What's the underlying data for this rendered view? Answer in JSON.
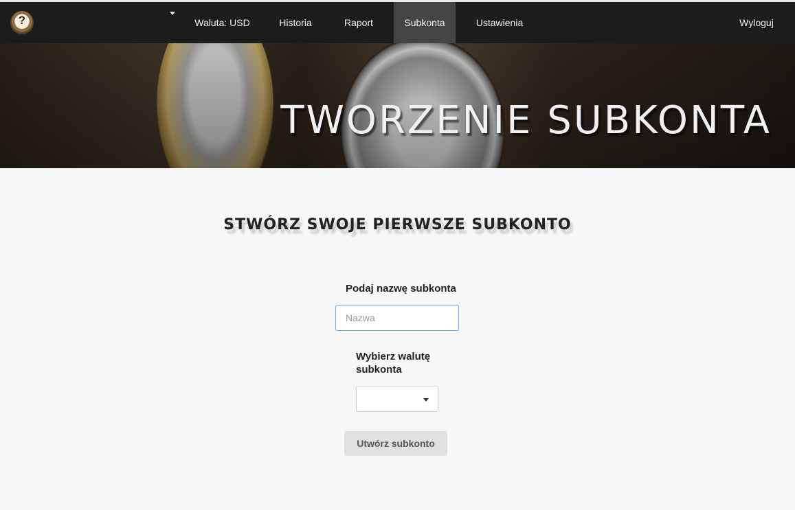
{
  "navbar": {
    "currency_label": "Waluta: USD",
    "items": [
      {
        "label": "Historia"
      },
      {
        "label": "Raport"
      },
      {
        "label": "Subkonta"
      },
      {
        "label": "Ustawienia"
      }
    ],
    "active_item": "Subkonta",
    "logout_label": "Wyloguj",
    "logo_icon": "question-mark-coin-logo"
  },
  "hero": {
    "title": "TWORZENIE SUBKONTA"
  },
  "form": {
    "heading": "STWÓRZ SWOJE PIERWSZE SUBKONTO",
    "name_label": "Podaj nazwę subkonta",
    "name_placeholder": "Nazwa",
    "name_value": "",
    "currency_label_line1": "Wybierz walutę",
    "currency_label_line2": "subkonta",
    "currency_selected": "",
    "submit_label": "Utwórz subkonto"
  },
  "colors": {
    "navbar_bg": "#1c1c1c",
    "active_nav_bg": "#444444",
    "page_bg": "#f7f7f7",
    "input_focus_border": "#66afe9",
    "button_bg": "#e0e0e0"
  }
}
